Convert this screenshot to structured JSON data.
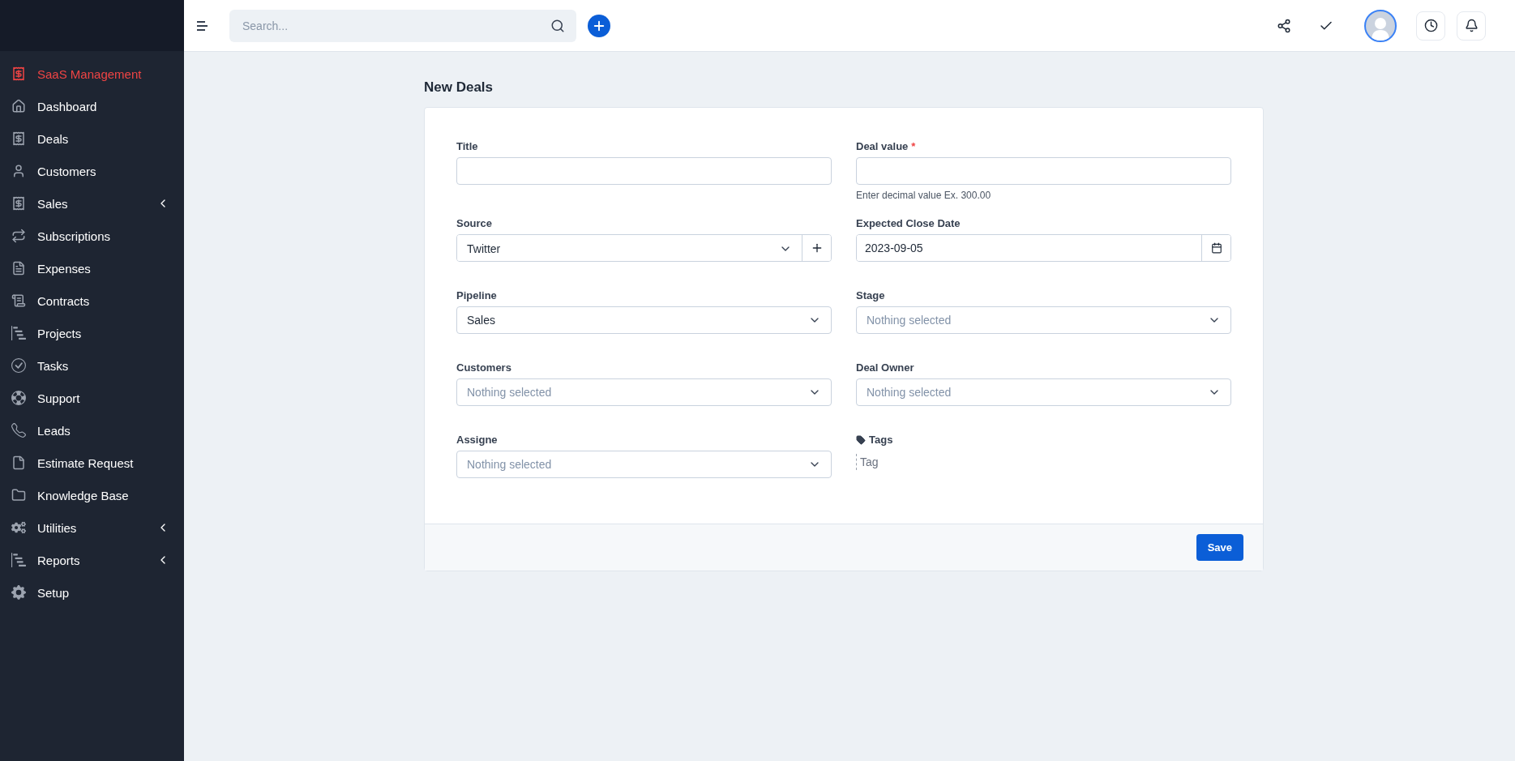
{
  "sidebar": {
    "items": [
      {
        "label": "SaaS Management",
        "selected": true,
        "has_submenu": false
      },
      {
        "label": "Dashboard",
        "selected": false,
        "has_submenu": false
      },
      {
        "label": "Deals",
        "selected": false,
        "has_submenu": false
      },
      {
        "label": "Customers",
        "selected": false,
        "has_submenu": false
      },
      {
        "label": "Sales",
        "selected": false,
        "has_submenu": true
      },
      {
        "label": "Subscriptions",
        "selected": false,
        "has_submenu": false
      },
      {
        "label": "Expenses",
        "selected": false,
        "has_submenu": false
      },
      {
        "label": "Contracts",
        "selected": false,
        "has_submenu": false
      },
      {
        "label": "Projects",
        "selected": false,
        "has_submenu": false
      },
      {
        "label": "Tasks",
        "selected": false,
        "has_submenu": false
      },
      {
        "label": "Support",
        "selected": false,
        "has_submenu": false
      },
      {
        "label": "Leads",
        "selected": false,
        "has_submenu": false
      },
      {
        "label": "Estimate Request",
        "selected": false,
        "has_submenu": false
      },
      {
        "label": "Knowledge Base",
        "selected": false,
        "has_submenu": false
      },
      {
        "label": "Utilities",
        "selected": false,
        "has_submenu": true
      },
      {
        "label": "Reports",
        "selected": false,
        "has_submenu": true
      },
      {
        "label": "Setup",
        "selected": false,
        "has_submenu": false
      }
    ]
  },
  "topbar": {
    "search": {
      "placeholder": "Search..."
    }
  },
  "page": {
    "title": "New Deals"
  },
  "form": {
    "fields": [
      {
        "kind": "text",
        "label": "Title"
      },
      {
        "kind": "text",
        "label": "Deal value",
        "required_mark": "*",
        "hint": "Enter decimal value Ex. 300.00"
      },
      {
        "kind": "select_add",
        "label": "Source",
        "value": "Twitter"
      },
      {
        "kind": "date",
        "label": "Expected Close Date",
        "value": "2023-09-05"
      },
      {
        "kind": "select",
        "label": "Pipeline",
        "value": "Sales"
      },
      {
        "kind": "select",
        "label": "Stage",
        "placeholder": "Nothing selected"
      },
      {
        "kind": "select",
        "label": "Customers",
        "placeholder": "Nothing selected"
      },
      {
        "kind": "select",
        "label": "Deal Owner",
        "placeholder": "Nothing selected"
      },
      {
        "kind": "select",
        "label": "Assigne",
        "placeholder": "Nothing selected"
      },
      {
        "kind": "tags",
        "label": "Tags",
        "placeholder": "Tag"
      }
    ],
    "save_button": "Save"
  }
}
